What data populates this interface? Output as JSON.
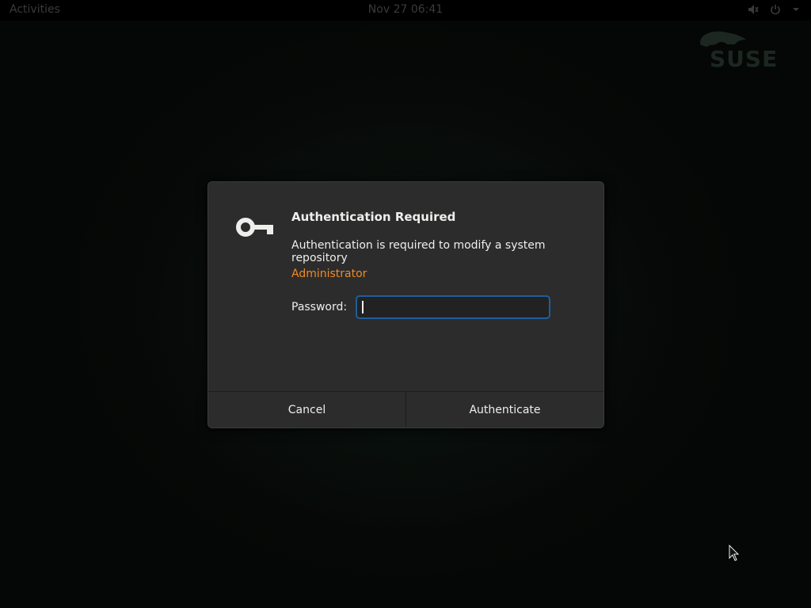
{
  "topbar": {
    "activities": "Activities",
    "clock": "Nov 27  06:41",
    "tray": {
      "volume_icon": "volume-muted-icon",
      "power_icon": "power-icon",
      "menu_icon": "chevron-down-icon"
    }
  },
  "desktop": {
    "logo_text": "SUSE"
  },
  "dialog": {
    "icon": "key-icon",
    "title": "Authentication Required",
    "message": "Authentication is required to modify a system repository",
    "user": "Administrator",
    "password_label": "Password:",
    "password_value": "",
    "cancel_label": "Cancel",
    "authenticate_label": "Authenticate"
  },
  "colors": {
    "accent_user": "#f08a24",
    "focus_border": "#215d9c",
    "dialog_bg": "#2c2c2c"
  }
}
